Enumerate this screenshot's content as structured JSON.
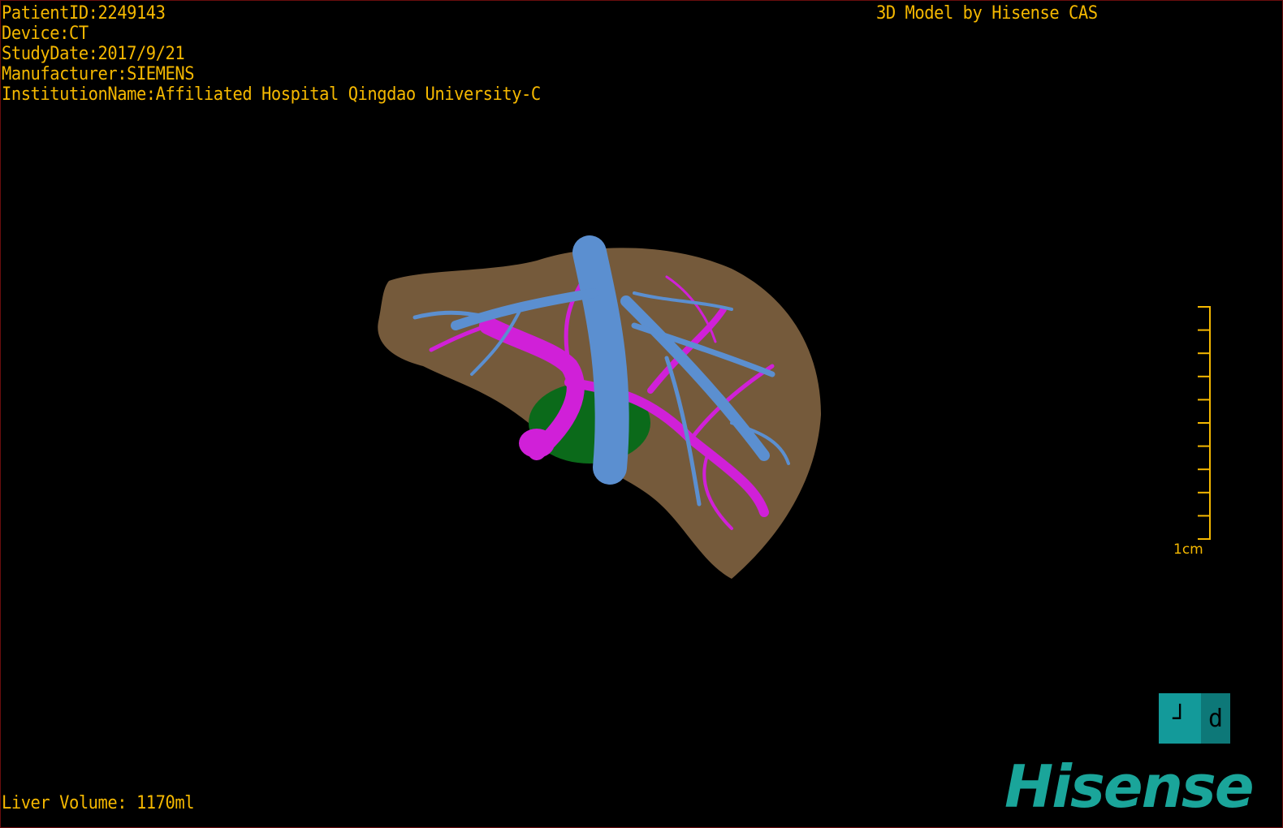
{
  "overlay": {
    "info_lines": [
      "PatientID:2249143",
      "Device:CT",
      "StudyDate:2017/9/21",
      "Manufacturer:SIEMENS",
      "InstitutionName:Affiliated Hospital Qingdao University-C"
    ],
    "title": "3D Model by Hisense CAS",
    "liver_volume": "Liver Volume: 1170ml"
  },
  "scale_bar": {
    "label": "1cm",
    "ticks": 10
  },
  "orientation_cube": {
    "face_left": "┘",
    "face_right": "d",
    "colors": [
      "#139a9a",
      "#0d7878"
    ]
  },
  "brand": {
    "logo": "Hisense",
    "color": "#1aa59a"
  },
  "model_colors": {
    "liver": "#8a6a45",
    "hepatic_vein": "#5b8fd0",
    "portal_vein": "#d020d8",
    "gallbladder": "#0b6a1a"
  },
  "text_color": "#f5b800"
}
